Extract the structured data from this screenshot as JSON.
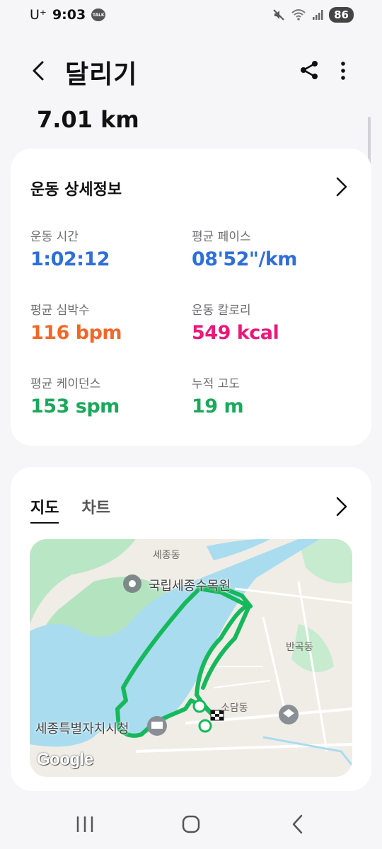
{
  "status": {
    "carrier": "U⁺",
    "time": "9:03",
    "talk_badge": "TALK",
    "battery": "86"
  },
  "header": {
    "title": "달리기"
  },
  "summary": {
    "distance": "7.01 km"
  },
  "details": {
    "title": "운동 상세정보",
    "metrics": [
      {
        "label": "운동 시간",
        "value": "1:02:12",
        "color": "#2f6fd8"
      },
      {
        "label": "평균 페이스",
        "value": "08'52\"/km",
        "color": "#2f6fd8"
      },
      {
        "label": "평균 심박수",
        "value": "116 bpm",
        "color": "#f0682a"
      },
      {
        "label": "운동 칼로리",
        "value": "549 kcal",
        "color": "#e8197a"
      },
      {
        "label": "평균 케이던스",
        "value": "153 spm",
        "color": "#1ba85a"
      },
      {
        "label": "누적 고도",
        "value": "19 m",
        "color": "#1ba85a"
      }
    ]
  },
  "map_card": {
    "tabs": [
      {
        "label": "지도",
        "active": true
      },
      {
        "label": "차트",
        "active": false
      }
    ],
    "map": {
      "labels": {
        "sejong_dong": "세종동",
        "arboretum": "국립세종수목원",
        "bangok_dong": "반곡동",
        "sodam_dong": "소담동",
        "city_hall": "세종특별자치시청"
      },
      "attribution": "Google",
      "route_color": "#16b85c"
    }
  },
  "icons": {
    "back": "chevron-left-icon",
    "share": "share-icon",
    "more": "more-vertical-icon",
    "details_chevron": "chevron-right-icon",
    "map_chevron": "chevron-right-icon"
  }
}
